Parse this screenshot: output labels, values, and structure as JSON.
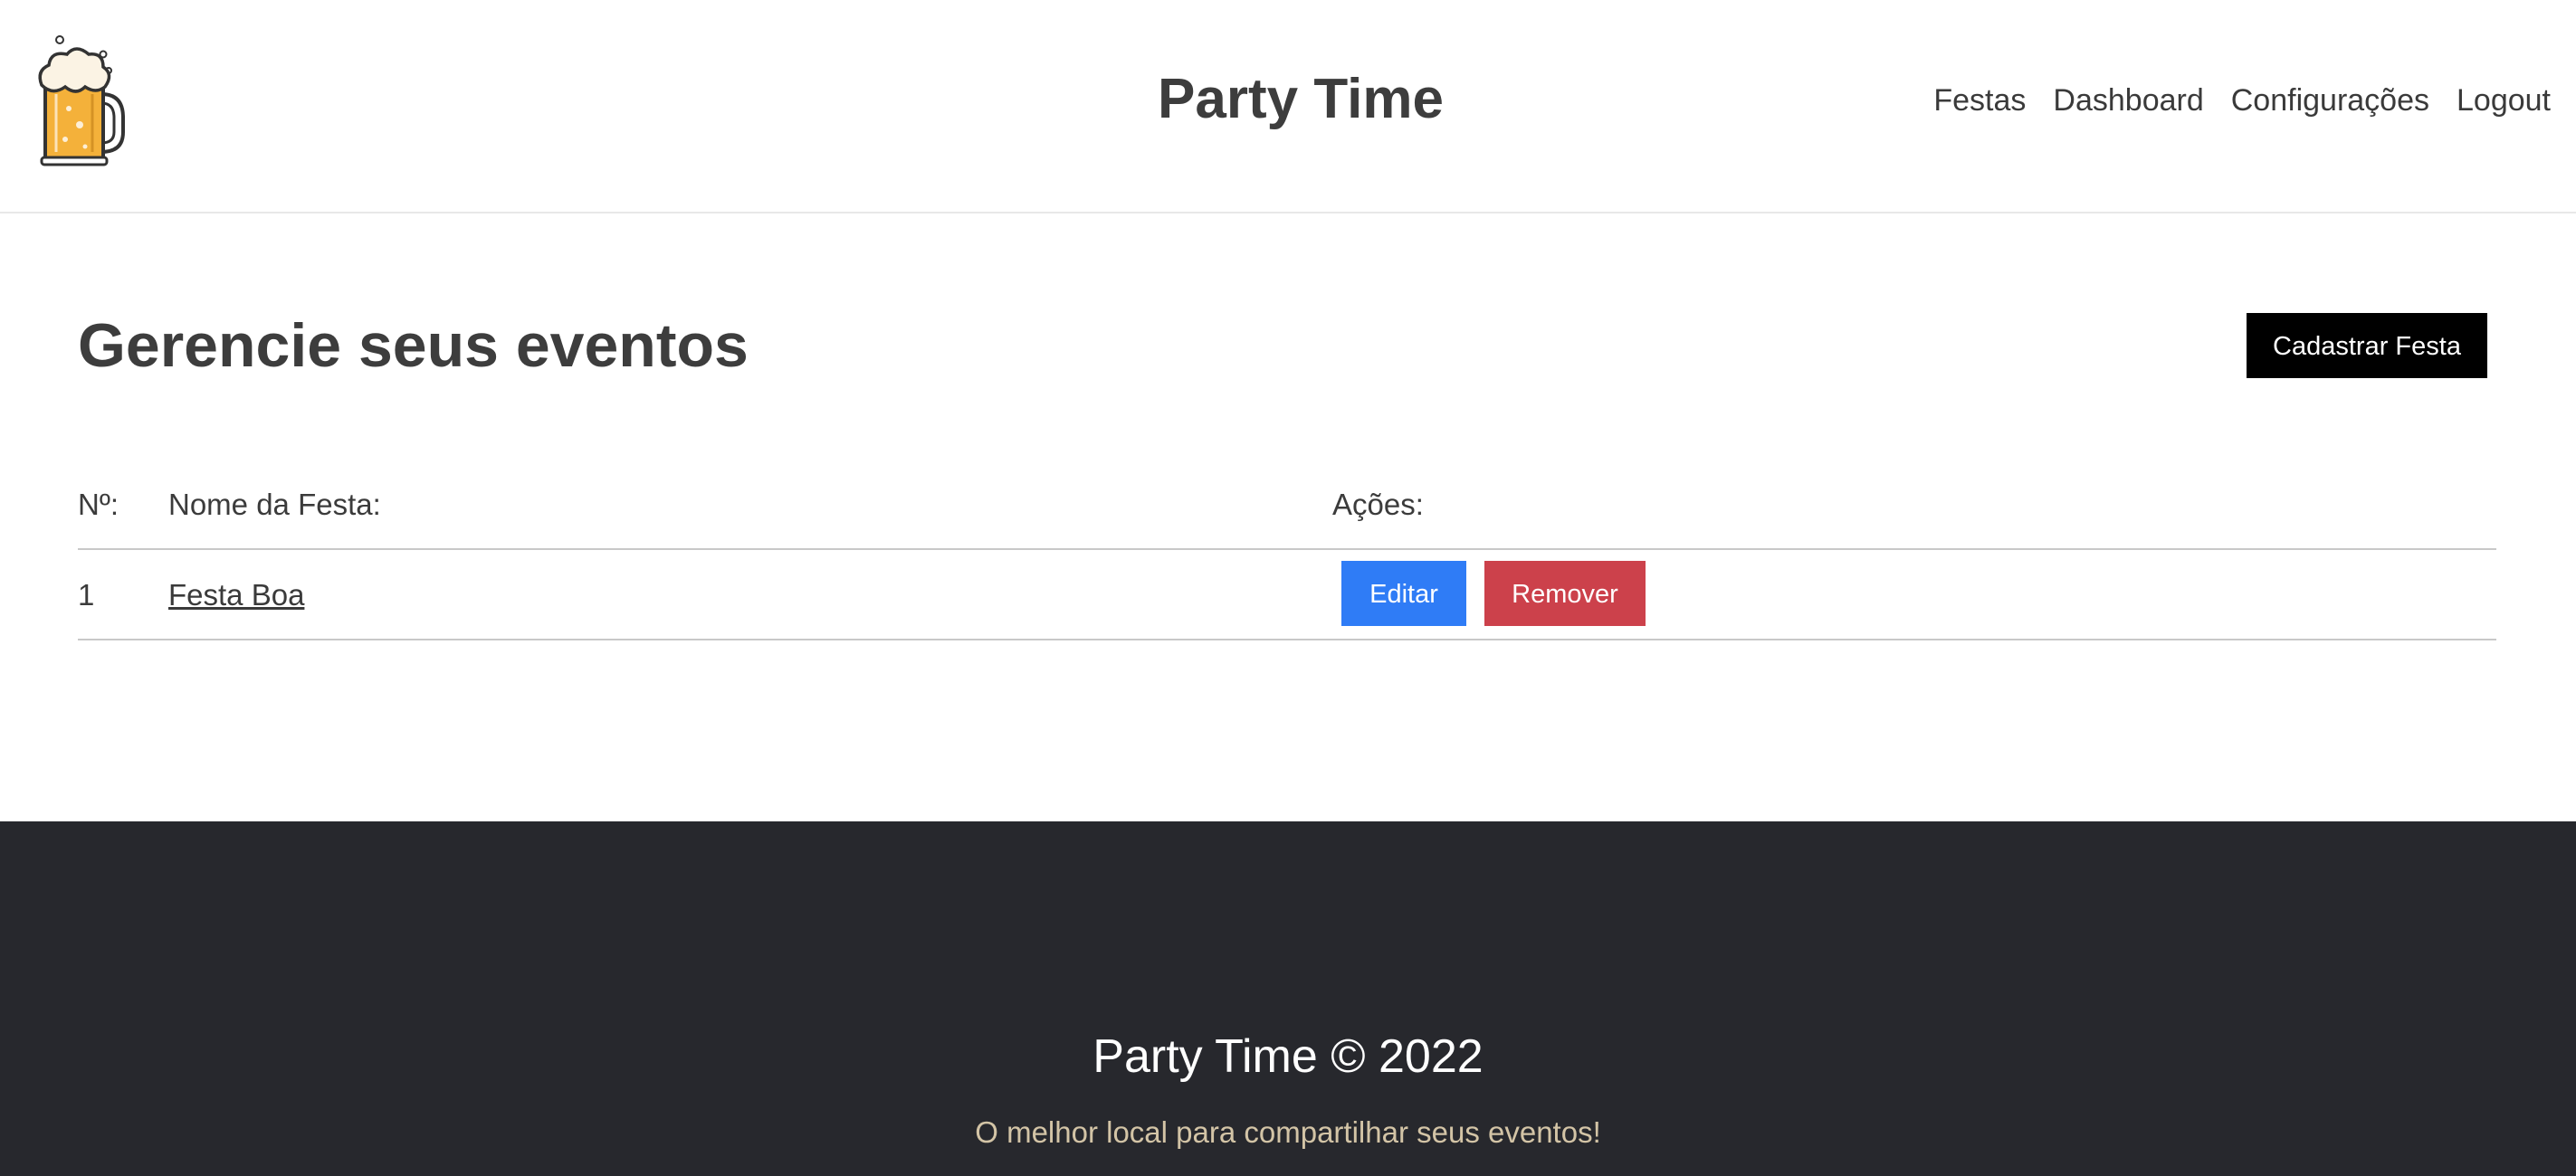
{
  "header": {
    "site_title": "Party Time",
    "nav": [
      "Festas",
      "Dashboard",
      "Configurações",
      "Logout"
    ]
  },
  "main": {
    "title": "Gerencie seus eventos",
    "create_button": "Cadastrar Festa",
    "table": {
      "headers": {
        "number": "Nº:",
        "name": "Nome da Festa:",
        "actions": "Ações:"
      },
      "rows": [
        {
          "number": "1",
          "name": "Festa Boa",
          "edit_label": "Editar",
          "remove_label": "Remover"
        }
      ]
    }
  },
  "footer": {
    "title": "Party Time © 2022",
    "tagline": "O melhor local para compartilhar seus eventos!"
  },
  "colors": {
    "edit_button": "#2f7cf6",
    "remove_button": "#cc414b",
    "create_button": "#000000",
    "footer_background": "#27282d",
    "footer_tagline": "#d3c4a6"
  },
  "icons": {
    "logo": "beer-mug-icon"
  }
}
